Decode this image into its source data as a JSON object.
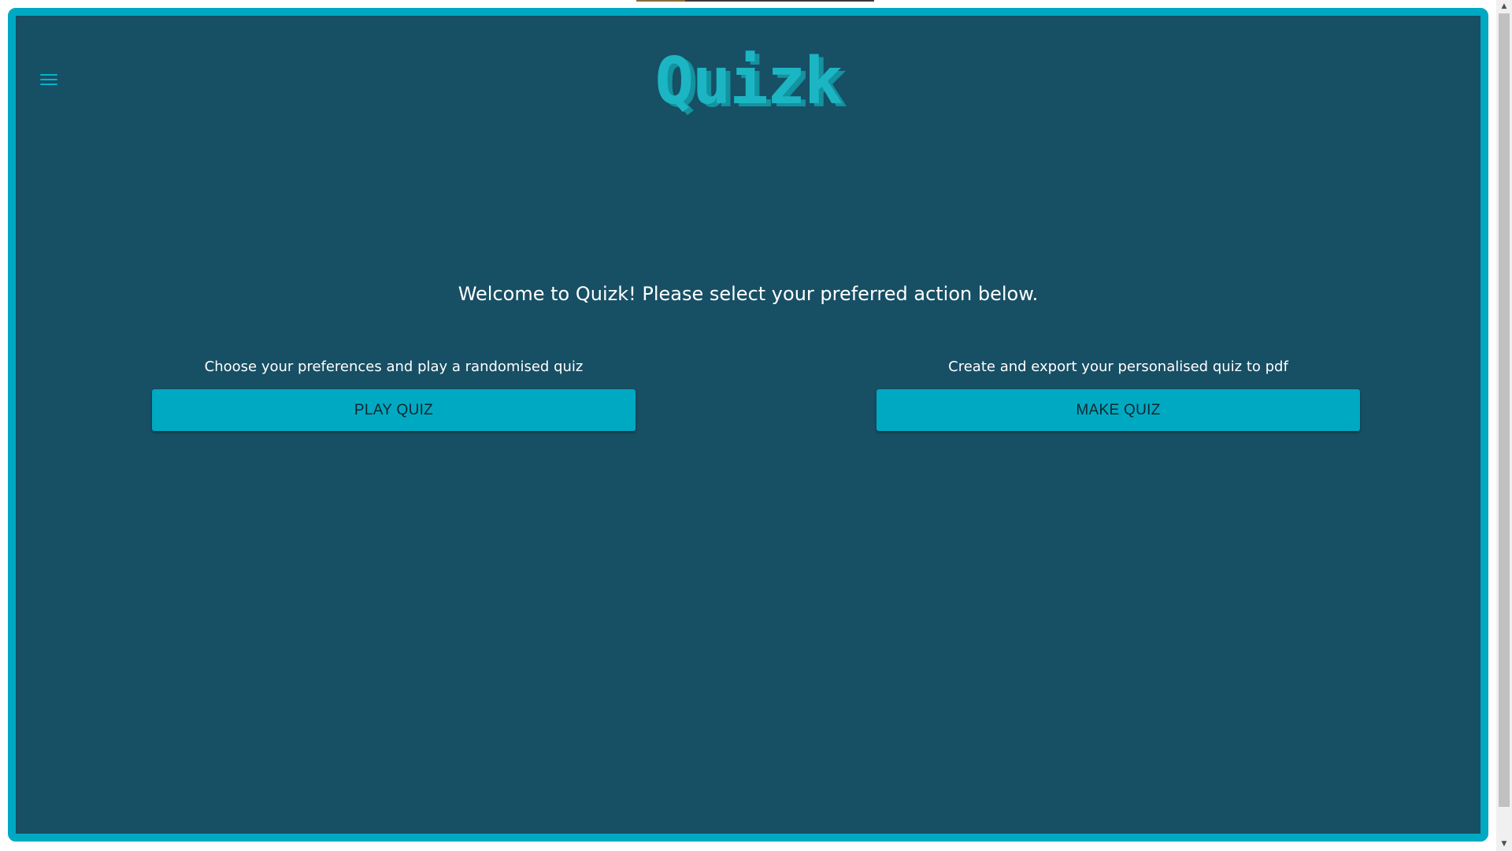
{
  "app": {
    "logo_text": "Quizk"
  },
  "header": {
    "menu_icon": "hamburger-menu-icon"
  },
  "main": {
    "welcome_text": "Welcome to Quizk! Please select your preferred action below.",
    "actions": [
      {
        "description": "Choose your preferences and play a randomised quiz",
        "button_label": "PLAY QUIZ"
      },
      {
        "description": "Create and export your personalised quiz to pdf",
        "button_label": "MAKE QUIZ"
      }
    ]
  },
  "scrollbar": {
    "up_icon": "▲",
    "down_icon": "▼"
  },
  "colors": {
    "frame_border": "#00a9c2",
    "background": "#174f64",
    "button": "#00a9c2",
    "logo": "#1cb5c3",
    "text": "#ffffff"
  }
}
